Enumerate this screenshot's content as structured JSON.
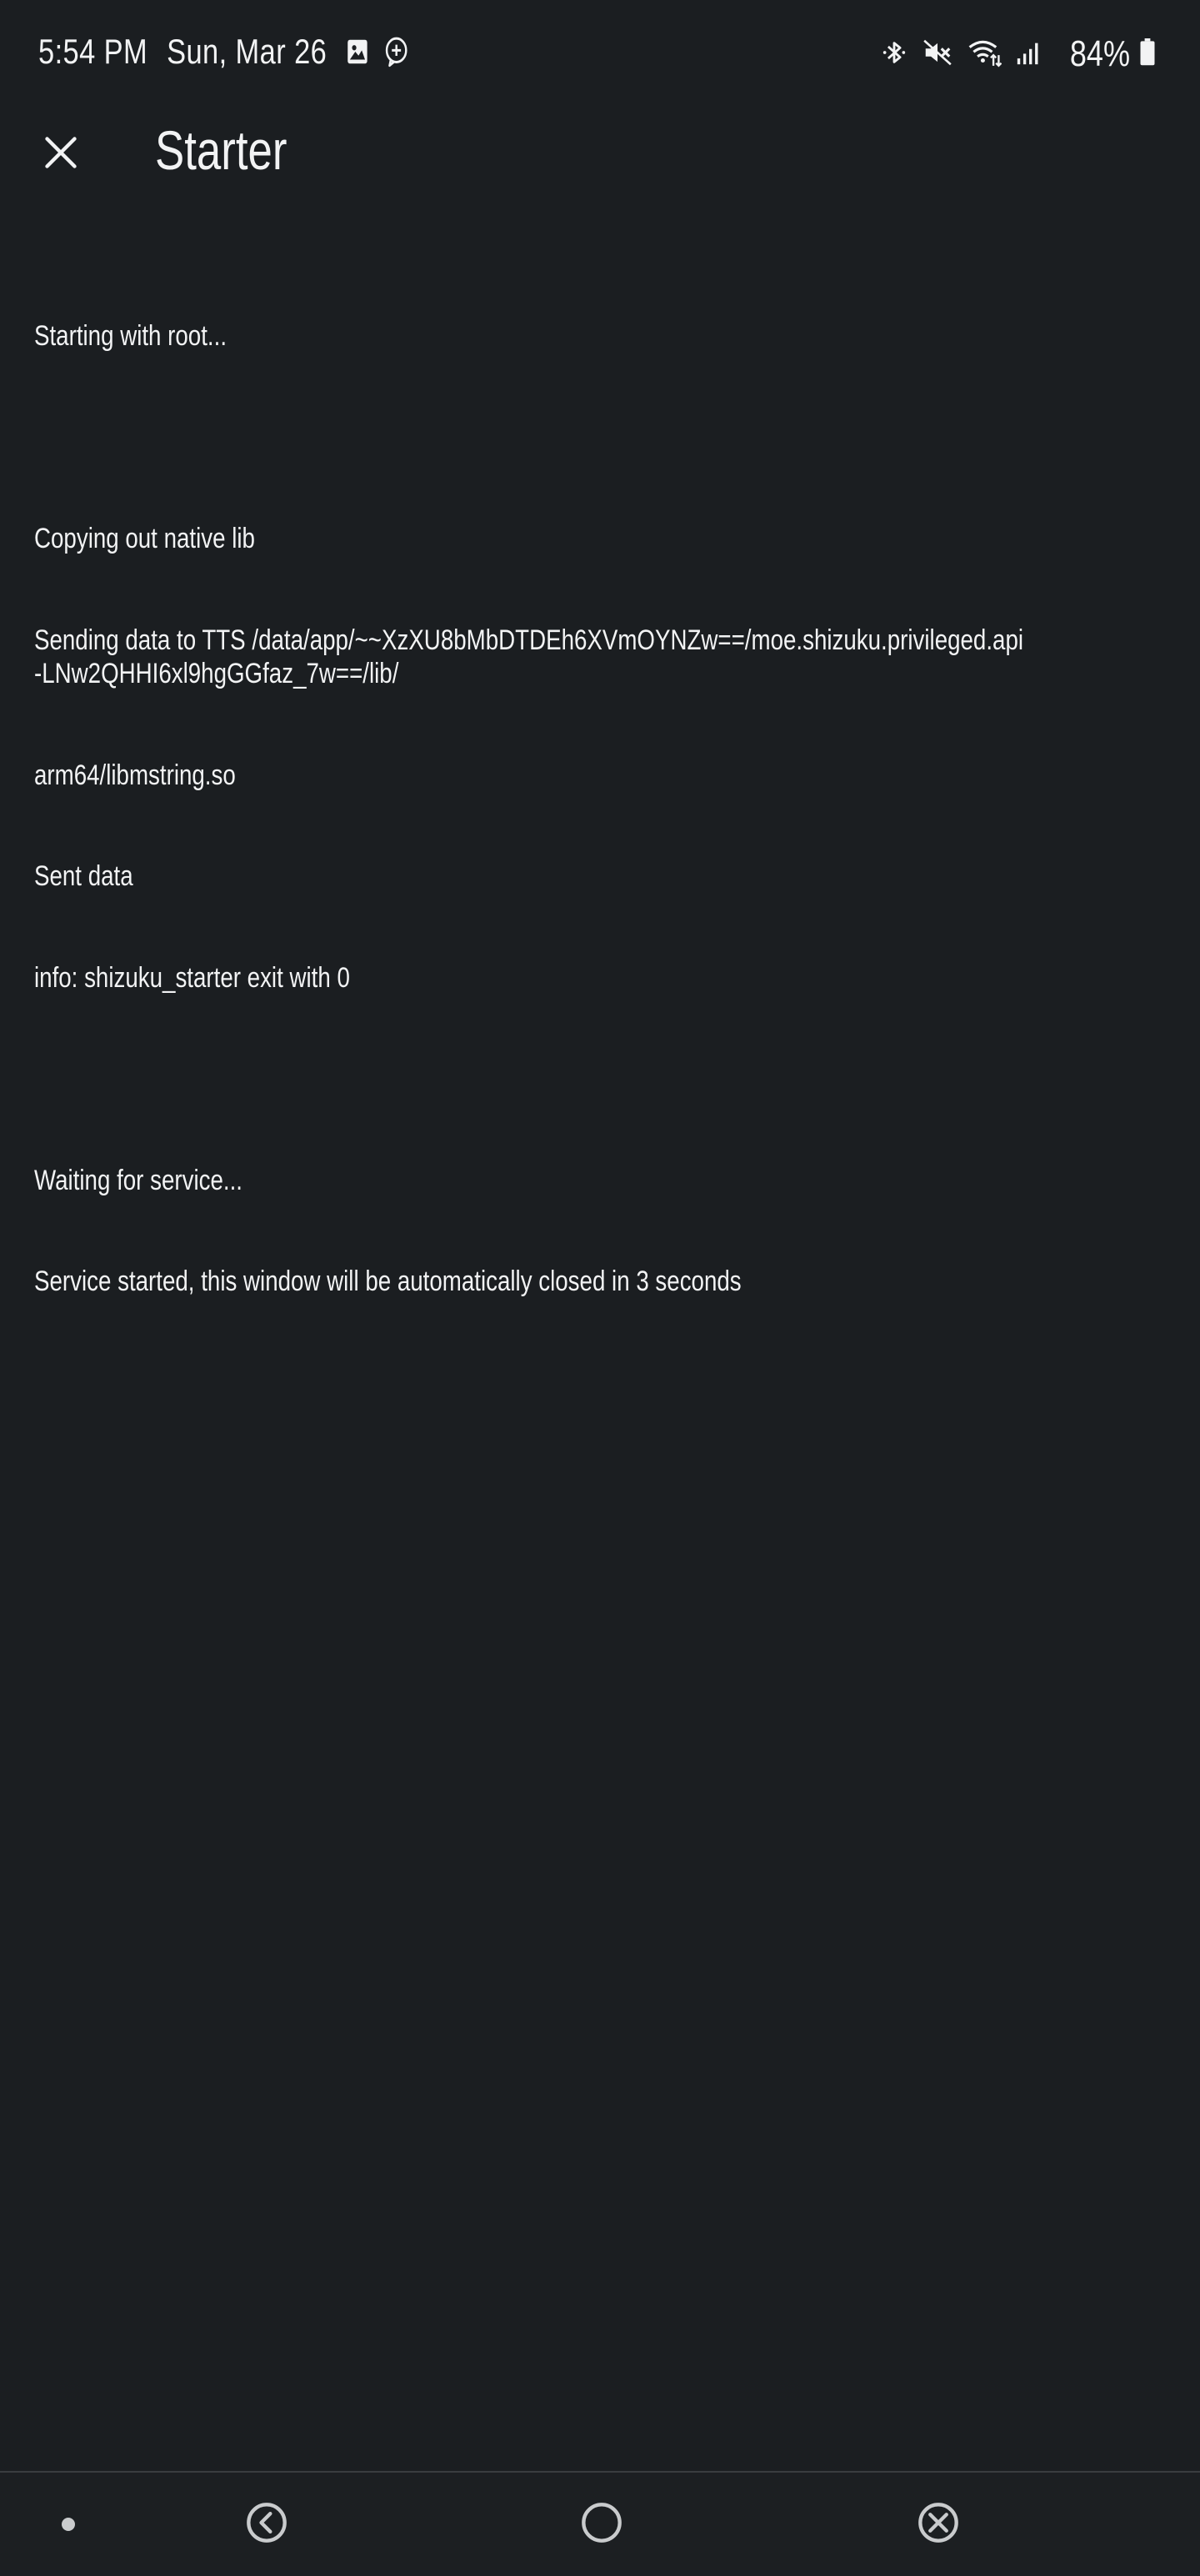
{
  "status_bar": {
    "time": "5:54 PM",
    "date": "Sun, Mar 26",
    "left_icons": [
      "image-icon",
      "chat-plus-icon"
    ],
    "right_icons": [
      "bluetooth-icon",
      "mute-icon",
      "wifi-icon",
      "signal-icon"
    ],
    "battery_percent": "84%",
    "battery_icon": "battery-icon"
  },
  "app_bar": {
    "title": "Starter",
    "close_icon": "close-icon"
  },
  "log": {
    "lines": [
      "Starting with root...",
      "",
      "Copying out native lib",
      "Sending data to TTS /data/app/~~XzXU8bMbDTDEh6XVmOYNZw==/moe.shizuku.privileged.api-LNw2QHHI6xl9hgGGfaz_7w==/lib/",
      "arm64/libmstring.so",
      "Sent data",
      "info: shizuku_starter exit with 0",
      "",
      "Waiting for service...",
      "Service started, this window will be automatically closed in 3 seconds"
    ]
  },
  "nav_bar": {
    "icons": [
      "dot-icon",
      "back-icon",
      "home-icon",
      "close-circle-icon"
    ]
  },
  "colors": {
    "background": "#1b1e21",
    "text": "#f2f3f4",
    "nav_background": "#1c1f22",
    "nav_icon": "#c9cbcd"
  }
}
